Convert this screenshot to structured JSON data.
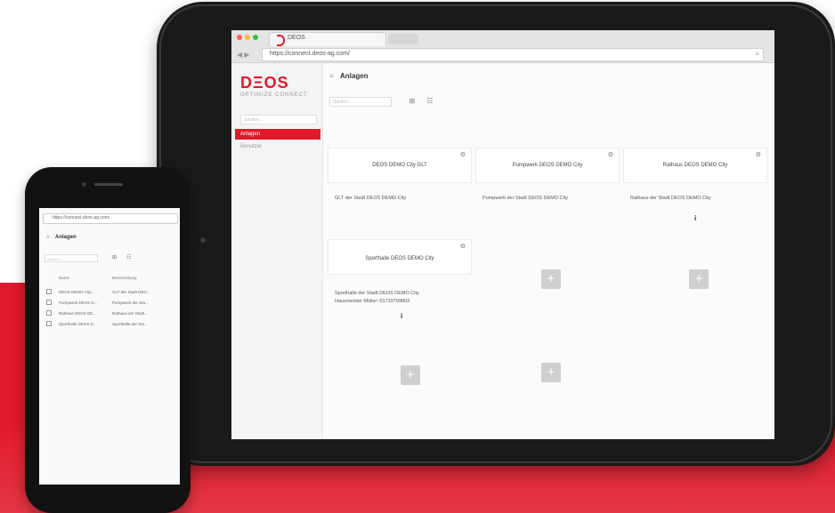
{
  "colors": {
    "brand_red": "#e01a2b",
    "device": "#1a1a1a"
  },
  "tablet": {
    "browser": {
      "tab_title": "DEOS",
      "url": "https://connect.deos-ag.com/",
      "back_icon": "back-arrow-icon",
      "menu_icon": "hamburger-icon"
    },
    "sidebar": {
      "logo": "DΞOS",
      "logo_sub": "OPTIMIZE CONNECT",
      "search_placeholder": "Suchen...",
      "items": [
        {
          "label": "Anlagen",
          "active": true
        },
        {
          "label": "Benutzer",
          "active": false
        }
      ]
    },
    "main": {
      "title": "Anlagen",
      "search_placeholder": "Suchen...",
      "cards": [
        {
          "title": "DEOS DEMO City GLT",
          "desc": "GLT der Stadt DEOS DEMO City"
        },
        {
          "title": "Pumpwerk DEOS DEMO City",
          "desc": "Pumpwerk der Stadt DEOS DEMO City"
        },
        {
          "title": "Rathaus DEOS DEMO City",
          "desc": "Rathaus der Stadt DEOS DEMO City"
        },
        {
          "title": "Sporthalle DEOS DEMO City",
          "desc": "Sporthalle der Stadt DEOS DEMO City",
          "desc2": "Hausmeister Müller: 01733799803"
        }
      ],
      "info_glyph": "i",
      "add_glyph": "+"
    }
  },
  "phone": {
    "url": "https://connect.deos-ag.com/",
    "title": "Anlagen",
    "search_placeholder": "Suchen...",
    "columns": [
      "Name",
      "Beschreibung"
    ],
    "rows": [
      {
        "name": "DEOS DEMO City...",
        "desc": "GLT der Stadt DEO..."
      },
      {
        "name": "Pumpwerk DEOS D...",
        "desc": "Pumpwerk der Sta..."
      },
      {
        "name": "Rathaus DEOS DE...",
        "desc": "Rathaus der Stadt..."
      },
      {
        "name": "Sporthalle DEOS D...",
        "desc": "Sporthalle der Sta..."
      }
    ]
  }
}
